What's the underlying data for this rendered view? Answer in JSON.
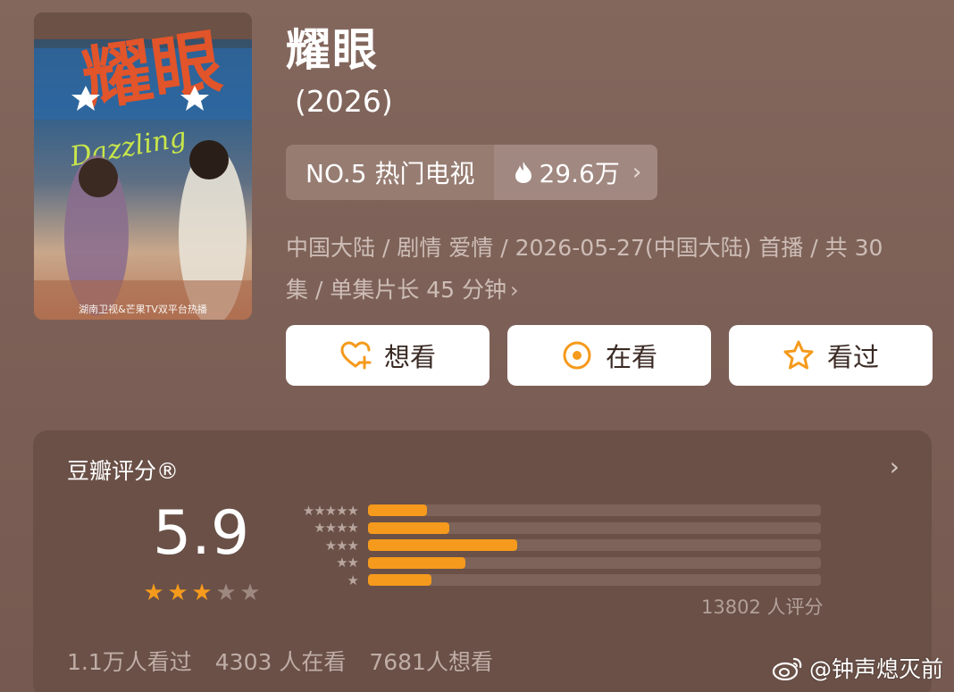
{
  "poster": {
    "caption": "湖南卫视&芒果TV双平台热播",
    "art_title": "Dazzling"
  },
  "title": "耀眼",
  "year": "(2026)",
  "rank": {
    "label": "NO.5 热门电视",
    "heat": "29.6万"
  },
  "meta": {
    "line1": "中国大陆 / 剧情 爱情 / 2026-05-27(中国大陆) 首播 / 共 30",
    "line2": "集 / 单集片长 45 分钟"
  },
  "actions": [
    {
      "label": "想看",
      "icon": "heart-plus-icon"
    },
    {
      "label": "在看",
      "icon": "target-icon"
    },
    {
      "label": "看过",
      "icon": "star-outline-icon"
    }
  ],
  "rating": {
    "title": "豆瓣评分®",
    "score": "5.9",
    "stars": 3,
    "max_stars": 5,
    "distribution": [
      {
        "stars": 5,
        "label": "★★★★★",
        "fraction": 0.13
      },
      {
        "stars": 4,
        "label": "★★★★",
        "fraction": 0.18
      },
      {
        "stars": 3,
        "label": "★★★",
        "fraction": 0.33
      },
      {
        "stars": 2,
        "label": "★★",
        "fraction": 0.215
      },
      {
        "stars": 1,
        "label": "★",
        "fraction": 0.14
      }
    ],
    "votes": "13802 人评分",
    "counts": [
      "1.1万人看过",
      "4303 人在看",
      "7681人想看"
    ]
  },
  "watermark": "@钟声熄灭前",
  "colors": {
    "accent": "#f59a1c",
    "card": "#6a5047",
    "background": "#7e6259"
  }
}
